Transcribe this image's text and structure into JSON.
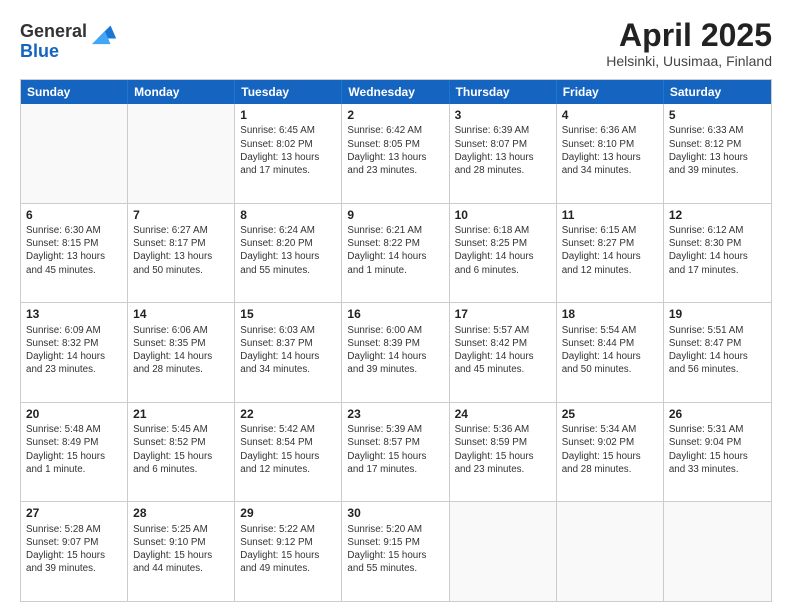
{
  "header": {
    "logo_general": "General",
    "logo_blue": "Blue",
    "title": "April 2025",
    "subtitle": "Helsinki, Uusimaa, Finland"
  },
  "days_of_week": [
    "Sunday",
    "Monday",
    "Tuesday",
    "Wednesday",
    "Thursday",
    "Friday",
    "Saturday"
  ],
  "weeks": [
    [
      {
        "day": "",
        "info": ""
      },
      {
        "day": "",
        "info": ""
      },
      {
        "day": "1",
        "info": "Sunrise: 6:45 AM\nSunset: 8:02 PM\nDaylight: 13 hours and 17 minutes."
      },
      {
        "day": "2",
        "info": "Sunrise: 6:42 AM\nSunset: 8:05 PM\nDaylight: 13 hours and 23 minutes."
      },
      {
        "day": "3",
        "info": "Sunrise: 6:39 AM\nSunset: 8:07 PM\nDaylight: 13 hours and 28 minutes."
      },
      {
        "day": "4",
        "info": "Sunrise: 6:36 AM\nSunset: 8:10 PM\nDaylight: 13 hours and 34 minutes."
      },
      {
        "day": "5",
        "info": "Sunrise: 6:33 AM\nSunset: 8:12 PM\nDaylight: 13 hours and 39 minutes."
      }
    ],
    [
      {
        "day": "6",
        "info": "Sunrise: 6:30 AM\nSunset: 8:15 PM\nDaylight: 13 hours and 45 minutes."
      },
      {
        "day": "7",
        "info": "Sunrise: 6:27 AM\nSunset: 8:17 PM\nDaylight: 13 hours and 50 minutes."
      },
      {
        "day": "8",
        "info": "Sunrise: 6:24 AM\nSunset: 8:20 PM\nDaylight: 13 hours and 55 minutes."
      },
      {
        "day": "9",
        "info": "Sunrise: 6:21 AM\nSunset: 8:22 PM\nDaylight: 14 hours and 1 minute."
      },
      {
        "day": "10",
        "info": "Sunrise: 6:18 AM\nSunset: 8:25 PM\nDaylight: 14 hours and 6 minutes."
      },
      {
        "day": "11",
        "info": "Sunrise: 6:15 AM\nSunset: 8:27 PM\nDaylight: 14 hours and 12 minutes."
      },
      {
        "day": "12",
        "info": "Sunrise: 6:12 AM\nSunset: 8:30 PM\nDaylight: 14 hours and 17 minutes."
      }
    ],
    [
      {
        "day": "13",
        "info": "Sunrise: 6:09 AM\nSunset: 8:32 PM\nDaylight: 14 hours and 23 minutes."
      },
      {
        "day": "14",
        "info": "Sunrise: 6:06 AM\nSunset: 8:35 PM\nDaylight: 14 hours and 28 minutes."
      },
      {
        "day": "15",
        "info": "Sunrise: 6:03 AM\nSunset: 8:37 PM\nDaylight: 14 hours and 34 minutes."
      },
      {
        "day": "16",
        "info": "Sunrise: 6:00 AM\nSunset: 8:39 PM\nDaylight: 14 hours and 39 minutes."
      },
      {
        "day": "17",
        "info": "Sunrise: 5:57 AM\nSunset: 8:42 PM\nDaylight: 14 hours and 45 minutes."
      },
      {
        "day": "18",
        "info": "Sunrise: 5:54 AM\nSunset: 8:44 PM\nDaylight: 14 hours and 50 minutes."
      },
      {
        "day": "19",
        "info": "Sunrise: 5:51 AM\nSunset: 8:47 PM\nDaylight: 14 hours and 56 minutes."
      }
    ],
    [
      {
        "day": "20",
        "info": "Sunrise: 5:48 AM\nSunset: 8:49 PM\nDaylight: 15 hours and 1 minute."
      },
      {
        "day": "21",
        "info": "Sunrise: 5:45 AM\nSunset: 8:52 PM\nDaylight: 15 hours and 6 minutes."
      },
      {
        "day": "22",
        "info": "Sunrise: 5:42 AM\nSunset: 8:54 PM\nDaylight: 15 hours and 12 minutes."
      },
      {
        "day": "23",
        "info": "Sunrise: 5:39 AM\nSunset: 8:57 PM\nDaylight: 15 hours and 17 minutes."
      },
      {
        "day": "24",
        "info": "Sunrise: 5:36 AM\nSunset: 8:59 PM\nDaylight: 15 hours and 23 minutes."
      },
      {
        "day": "25",
        "info": "Sunrise: 5:34 AM\nSunset: 9:02 PM\nDaylight: 15 hours and 28 minutes."
      },
      {
        "day": "26",
        "info": "Sunrise: 5:31 AM\nSunset: 9:04 PM\nDaylight: 15 hours and 33 minutes."
      }
    ],
    [
      {
        "day": "27",
        "info": "Sunrise: 5:28 AM\nSunset: 9:07 PM\nDaylight: 15 hours and 39 minutes."
      },
      {
        "day": "28",
        "info": "Sunrise: 5:25 AM\nSunset: 9:10 PM\nDaylight: 15 hours and 44 minutes."
      },
      {
        "day": "29",
        "info": "Sunrise: 5:22 AM\nSunset: 9:12 PM\nDaylight: 15 hours and 49 minutes."
      },
      {
        "day": "30",
        "info": "Sunrise: 5:20 AM\nSunset: 9:15 PM\nDaylight: 15 hours and 55 minutes."
      },
      {
        "day": "",
        "info": ""
      },
      {
        "day": "",
        "info": ""
      },
      {
        "day": "",
        "info": ""
      }
    ]
  ]
}
